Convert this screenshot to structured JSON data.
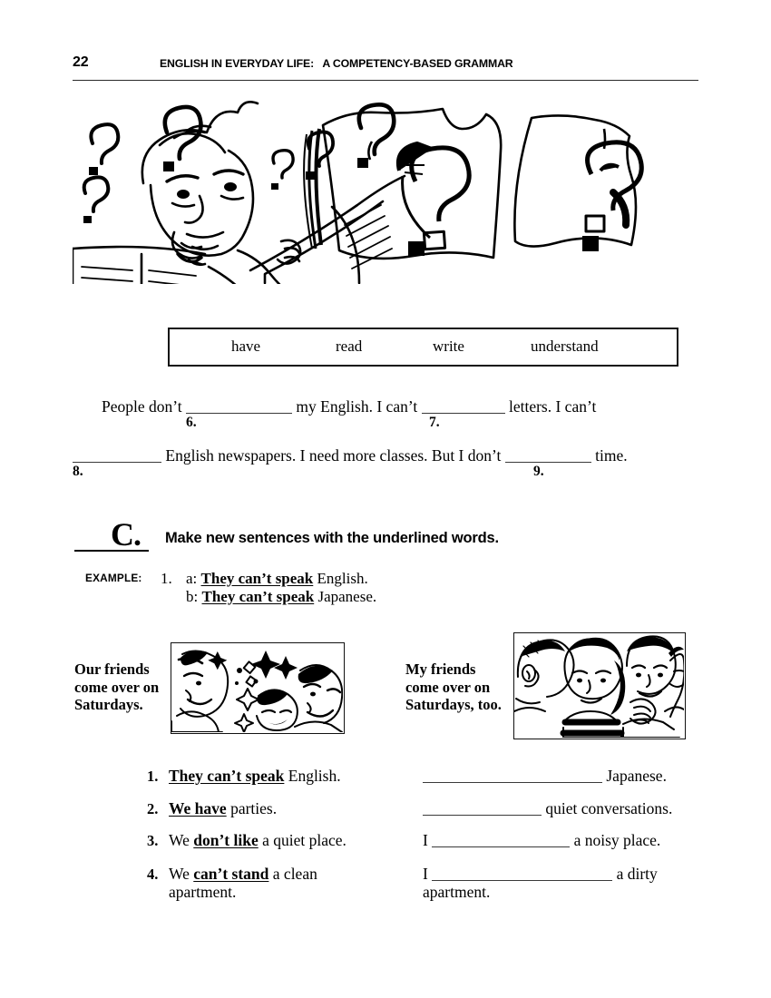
{
  "header": {
    "page_number": "22",
    "book_title": "ENGLISH IN EVERYDAY LIFE:   A COMPETENCY-BASED GRAMMAR"
  },
  "illustration": {
    "alt": "confused-man-reading-newspaper-with-question-marks"
  },
  "word_bank": {
    "words": [
      "have",
      "read",
      "write",
      "understand"
    ]
  },
  "cloze_paragraph": {
    "line1_part1": "People don’t",
    "line1_part2": "my English. I can’t",
    "line1_part3": "letters. I can’t",
    "line2_part1": "English newspapers. I need more classes. But I don’t",
    "line2_part2": "time.",
    "numbers": [
      "6.",
      "7.",
      "8.",
      "9."
    ]
  },
  "section_c": {
    "letter": "C.",
    "title": "Make new sentences with the underlined words.",
    "example_label": "EXAMPLE:",
    "example_number": "1.",
    "example_a_tag": "a:",
    "example_a_underlined": "They can’t speak",
    "example_a_rest": "English.",
    "example_b_tag": "b:",
    "example_b_underlined": "They can’t speak",
    "example_b_rest": "Japanese."
  },
  "pictures": {
    "left_caption": "Our friends\ncome over on\nSaturdays.",
    "left_image_alt": "three-laughing-friends-at-party",
    "right_caption": "My friends\ncome over on\nSaturdays, too.",
    "right_image_alt": "four-friends-in-quiet-conversation"
  },
  "exercises": [
    {
      "number": "1.",
      "left_underlined": "They can’t speak",
      "left_rest": "English.",
      "right_prefix": "",
      "right_suffix": "Japanese."
    },
    {
      "number": "2.",
      "left_underlined": "We have",
      "left_rest": "parties.",
      "right_prefix": "",
      "right_suffix": "quiet conversations."
    },
    {
      "number": "3.",
      "left_pre": "We",
      "left_underlined": "don’t like",
      "left_rest": "a quiet place.",
      "right_prefix": "I",
      "right_suffix": "a noisy place."
    },
    {
      "number": "4.",
      "left_pre": "We",
      "left_underlined": "can’t stand",
      "left_rest": "a clean",
      "left_wrap": "apartment.",
      "right_prefix": "I",
      "right_suffix": "a dirty",
      "right_wrap": "apartment."
    }
  ]
}
